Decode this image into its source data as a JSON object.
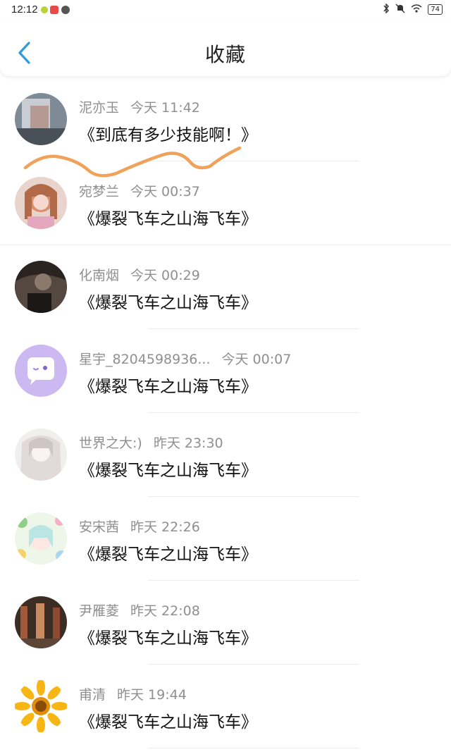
{
  "status_bar": {
    "time": "12:12",
    "battery": "74",
    "icons": [
      "wechat-icon",
      "app-icon",
      "basketball-icon",
      "bluetooth-icon",
      "mute-icon",
      "wifi-icon",
      "battery-icon"
    ]
  },
  "header": {
    "title": "收藏",
    "back_icon": "chevron-left-icon"
  },
  "colors": {
    "accent": "#2d9cdb",
    "scribble": "#f0a15a",
    "meta_text": "#8f8f8f"
  },
  "items": [
    {
      "name": "泥亦玉",
      "time": "今天 11:42",
      "content": "《到底有多少技能啊！》"
    },
    {
      "name": "宛梦兰",
      "time": "今天 00:37",
      "content": "《爆裂飞车之山海飞车》"
    },
    {
      "name": "化南烟",
      "time": "今天 00:29",
      "content": "《爆裂飞车之山海飞车》"
    },
    {
      "name": "星宇_8204598936...",
      "time": "今天 00:07",
      "content": "《爆裂飞车之山海飞车》"
    },
    {
      "name": "世界之大:)",
      "time": "昨天 23:30",
      "content": "《爆裂飞车之山海飞车》"
    },
    {
      "name": "安宋茜",
      "time": "昨天 22:26",
      "content": "《爆裂飞车之山海飞车》"
    },
    {
      "name": "尹雁菱",
      "time": "昨天 22:08",
      "content": "《爆裂飞车之山海飞车》"
    },
    {
      "name": "甫清",
      "time": "昨天 19:44",
      "content": "《爆裂飞车之山海飞车》"
    }
  ]
}
